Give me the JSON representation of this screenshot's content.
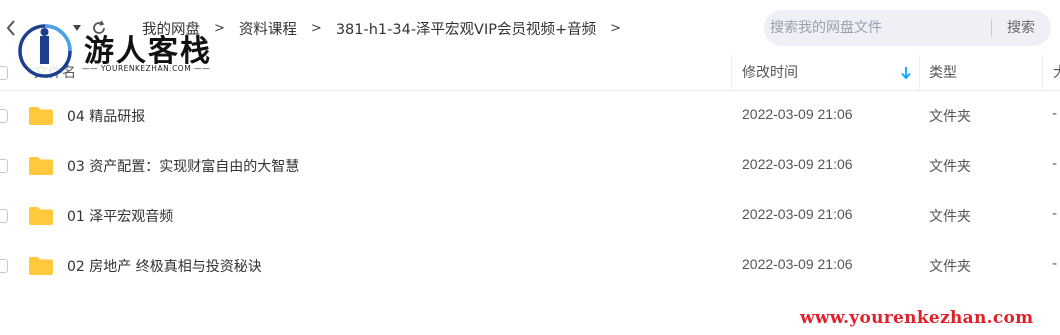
{
  "nav": {
    "back_icon": "chevron-left-icon",
    "dropdown_icon": "caret-down-icon",
    "refresh_icon": "refresh-icon"
  },
  "breadcrumb": {
    "items": [
      "我的网盘",
      "资料课程",
      "381-h1-34-泽平宏观VIP会员视频+音频"
    ],
    "separator": ">"
  },
  "search": {
    "placeholder": "搜索我的网盘文件",
    "button_label": "搜索"
  },
  "watermark": {
    "logo_text": "游人客栈",
    "logo_subtext": "—— YOURENKEZHAN.COM ——",
    "url": "www.yourenkezhan.com",
    "url_color": "#e0202a"
  },
  "table": {
    "headers": {
      "name": "文件名",
      "modified": "修改时间",
      "type": "类型",
      "size": "大"
    },
    "sort_icon": "arrow-down-icon",
    "rows": [
      {
        "name": "04 精品研报",
        "modified": "2022-03-09 21:06",
        "type": "文件夹",
        "size": "-"
      },
      {
        "name": "03 资产配置：实现财富自由的大智慧",
        "modified": "2022-03-09 21:06",
        "type": "文件夹",
        "size": "-"
      },
      {
        "name": "01 泽平宏观音频",
        "modified": "2022-03-09 21:06",
        "type": "文件夹",
        "size": "-"
      },
      {
        "name": "02 房地产 终极真相与投资秘诀",
        "modified": "2022-03-09 21:06",
        "type": "文件夹",
        "size": "-"
      }
    ]
  },
  "colors": {
    "folder": "#ffc83d",
    "accent": "#06a7ff",
    "search_bg": "#eef0f6"
  }
}
